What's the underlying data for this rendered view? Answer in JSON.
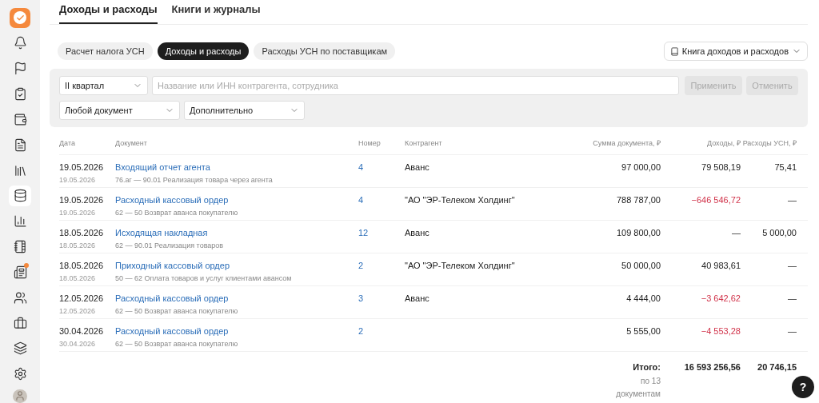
{
  "sidebar": {
    "items": [
      {
        "selected": false,
        "notification": false
      },
      {
        "selected": false,
        "notification": false
      },
      {
        "selected": false,
        "notification": false
      },
      {
        "selected": false,
        "notification": false
      },
      {
        "selected": false,
        "notification": false
      },
      {
        "selected": false,
        "notification": false
      },
      {
        "selected": true,
        "notification": false
      },
      {
        "selected": false,
        "notification": false
      },
      {
        "selected": false,
        "notification": false
      },
      {
        "selected": false,
        "notification": true
      },
      {
        "selected": false,
        "notification": false
      },
      {
        "selected": false,
        "notification": false
      },
      {
        "selected": false,
        "notification": false
      },
      {
        "selected": false,
        "notification": false
      }
    ]
  },
  "tabs": [
    {
      "label": "Доходы и расходы",
      "selected": true
    },
    {
      "label": "Книги и журналы",
      "selected": false
    }
  ],
  "segments": [
    {
      "label": "Расчет налога УСН",
      "selected": false
    },
    {
      "label": "Доходы и расходы",
      "selected": true
    },
    {
      "label": "Расходы УСН по поставщикам",
      "selected": false
    }
  ],
  "book_button": "Книга доходов и расходов",
  "filters": {
    "period": "II квартал",
    "search": {
      "placeholder": "Название или ИНН контрагента, сотрудника"
    },
    "apply": "Применить",
    "cancel": "Отменить",
    "document_type": "Любой документ",
    "more": "Дополнительно"
  },
  "table": {
    "columns": [
      "Дата",
      "Документ",
      "Номер",
      "Контрагент",
      "Сумма документа, ₽",
      "Доходы, ₽",
      "Расходы УСН, ₽"
    ],
    "rows": [
      {
        "date": "19.05.2026",
        "sub_date": "19.05.2026",
        "document": "Входящий отчет агента",
        "entry": "76.аг — 90.01 Реализация товара через агента",
        "number": "4",
        "counterparty": "Аванс",
        "amount": "97 000,00",
        "income": "79 508,19",
        "income_negative": false,
        "expense": "75,41"
      },
      {
        "date": "19.05.2026",
        "sub_date": "19.05.2026",
        "document": "Расходный кассовый ордер",
        "entry": "62 — 50 Возврат аванса покупателю",
        "number": "4",
        "counterparty": "\"АО \"ЭР-Телеком Холдинг\"",
        "amount": "788 787,00",
        "income": "−646 546,72",
        "income_negative": true,
        "expense": "—"
      },
      {
        "date": "18.05.2026",
        "sub_date": "18.05.2026",
        "document": "Исходящая накладная",
        "entry": "62 — 90.01 Реализация товаров",
        "number": "12",
        "counterparty": "Аванс",
        "amount": "109 800,00",
        "income": "—",
        "income_negative": false,
        "expense": "5 000,00"
      },
      {
        "date": "18.05.2026",
        "sub_date": "18.05.2026",
        "document": "Приходный кассовый ордер",
        "entry": "50 — 62 Оплата товаров и услуг клиентами авансом",
        "number": "2",
        "counterparty": "\"АО \"ЭР-Телеком Холдинг\"",
        "amount": "50 000,00",
        "income": "40 983,61",
        "income_negative": false,
        "expense": "—"
      },
      {
        "date": "12.05.2026",
        "sub_date": "12.05.2026",
        "document": "Расходный кассовый ордер",
        "entry": "62 — 50 Возврат аванса покупателю",
        "number": "3",
        "counterparty": "Аванс",
        "amount": "4 444,00",
        "income": "−3 642,62",
        "income_negative": true,
        "expense": "—"
      },
      {
        "date": "30.04.2026",
        "sub_date": "30.04.2026",
        "document": "Расходный кассовый ордер",
        "entry": "62 — 50 Возврат аванса покупателю",
        "number": "2",
        "amount": "5 555,00",
        "income": "−4 553,28",
        "income_negative": true,
        "expense": "—"
      }
    ],
    "totals": {
      "label": "Итого:",
      "note": "по 13 документам",
      "income": "16 593 256,56",
      "expense": "20 746,15"
    }
  },
  "help": "?"
}
